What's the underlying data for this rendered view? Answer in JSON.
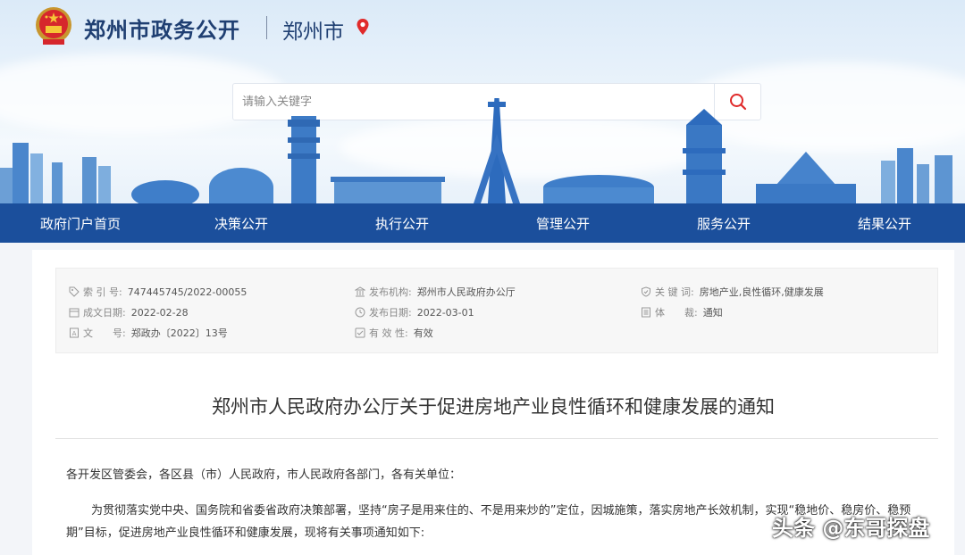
{
  "header": {
    "site_title": "郑州市政务公开",
    "city": "郑州市"
  },
  "search": {
    "placeholder": "请输入关键字"
  },
  "nav": {
    "items": [
      "政府门户首页",
      "决策公开",
      "执行公开",
      "管理公开",
      "服务公开",
      "结果公开"
    ]
  },
  "meta": {
    "index_label": "索 引 号:",
    "index_value": "747445745/2022-00055",
    "org_label": "发布机构:",
    "org_value": "郑州市人民政府办公厅",
    "keywords_label": "关 键 词:",
    "keywords_value": "房地产业,良性循环,健康发展",
    "created_label": "成文日期:",
    "created_value": "2022-02-28",
    "published_label": "发布日期:",
    "published_value": "2022-03-01",
    "genre_label": "体　　裁:",
    "genre_value": "通知",
    "docno_label": "文　　号:",
    "docno_value": "郑政办〔2022〕13号",
    "validity_label": "有 效 性:",
    "validity_value": "有效"
  },
  "document": {
    "title": "郑州市人民政府办公厅关于促进房地产业良性循环和健康发展的通知",
    "salutation": "各开发区管委会，各区县（市）人民政府，市人民政府各部门，各有关单位：",
    "para1_line1": "为贯彻落实党中央、国务院和省委省政府决策部署，坚持“房子是用来住的、不是用来炒的”定位，因城施策，落实房地产长效机制，实现“稳地价、稳房价、稳预",
    "para1_line2": "期”目标，促进房地产业良性循环和健康发展，现将有关事项通知如下:"
  },
  "watermark": "头条 @东哥探盘",
  "colors": {
    "nav_bg": "#1b4f9c",
    "title_text": "#1f3f72",
    "pin": "#e02a2a"
  }
}
